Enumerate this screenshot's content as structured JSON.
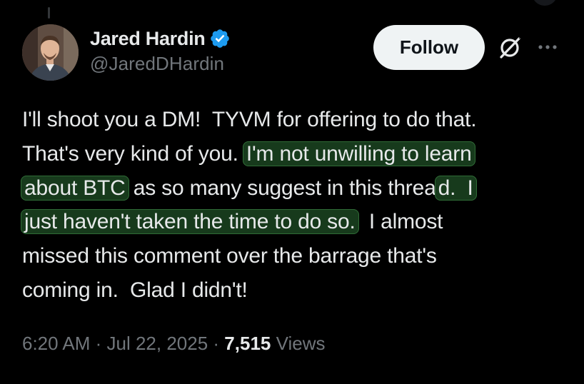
{
  "author": {
    "display_name": "Jared Hardin",
    "handle": "@JaredDHardin",
    "verified": true,
    "verified_color": "#1d9bf0"
  },
  "actions": {
    "follow_label": "Follow",
    "grok_icon": "grok-icon",
    "more_icon": "more-icon"
  },
  "tweet": {
    "lines": [
      [
        {
          "text": "I'll shoot you a DM!  TYVM for offering to do that.",
          "highlight": false
        }
      ],
      [
        {
          "text": "That's very kind of you. ",
          "highlight": false
        },
        {
          "text": "I'm not unwilling to learn",
          "highlight": true
        }
      ],
      [
        {
          "text": "about BTC",
          "highlight": true
        },
        {
          "text": " as so many suggest in this threa",
          "highlight": false
        },
        {
          "text": "d.  I",
          "highlight": true
        }
      ],
      [
        {
          "text": "just haven't taken the time to do so.",
          "highlight": true
        },
        {
          "text": "  I almost",
          "highlight": false
        }
      ],
      [
        {
          "text": "missed this comment over the barrage that's",
          "highlight": false
        }
      ],
      [
        {
          "text": "coming in.  Glad I didn't!",
          "highlight": false
        }
      ]
    ]
  },
  "meta": {
    "time": "6:20 AM",
    "separator": " · ",
    "date": "Jul 22, 2025",
    "views_count": "7,515",
    "views_label": " Views"
  },
  "colors": {
    "background": "#000000",
    "text": "#e7e9ea",
    "secondary": "#71767b",
    "highlight_bg": "#173a1c",
    "highlight_border": "#2f6b36"
  }
}
